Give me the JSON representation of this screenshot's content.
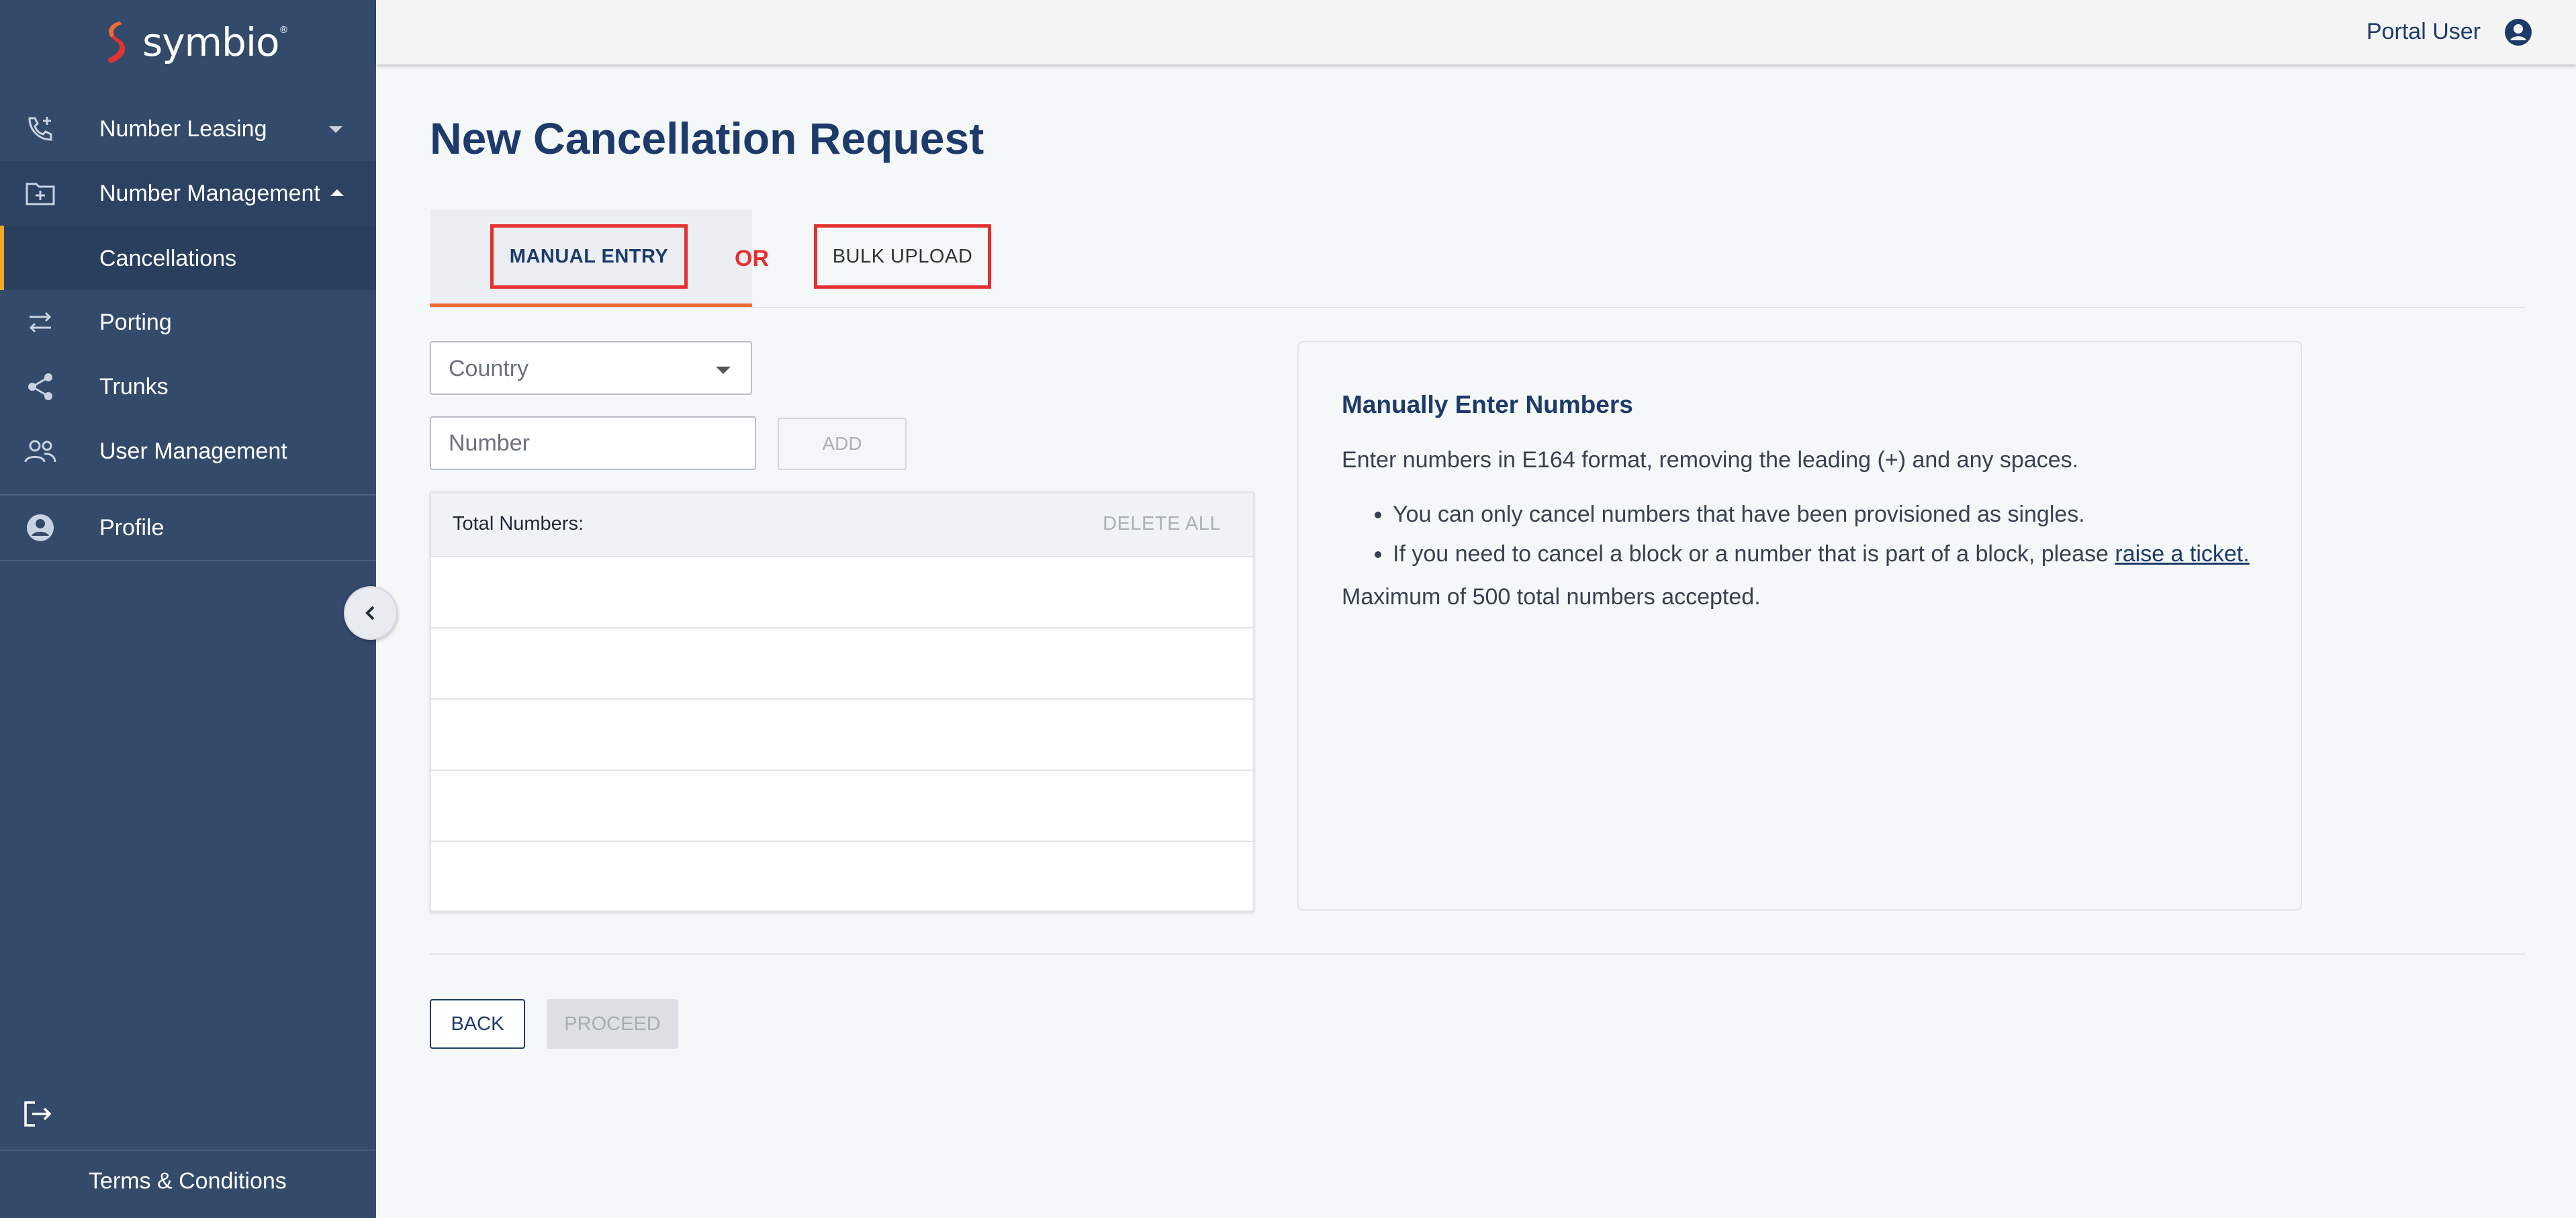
{
  "brand": {
    "name": "symbio",
    "trademark": "®",
    "accent": "#f26b32",
    "mark_color": "#e53030"
  },
  "sidebar": {
    "items": [
      {
        "label": "Number Leasing",
        "icon": "phone-plus-icon",
        "expanded": false
      },
      {
        "label": "Number Management",
        "icon": "folder-plus-icon",
        "expanded": true,
        "children": [
          {
            "label": "Cancellations",
            "active": true
          }
        ]
      },
      {
        "label": "Porting",
        "icon": "swap-arrows-icon"
      },
      {
        "label": "Trunks",
        "icon": "share-nodes-icon"
      },
      {
        "label": "User Management",
        "icon": "users-icon"
      },
      {
        "label": "Profile",
        "icon": "user-circle-icon"
      }
    ],
    "collapse_icon": "chevron-left-icon",
    "logout_icon": "logout-icon",
    "footer_link": "Terms & Conditions"
  },
  "header": {
    "user_name": "Portal User",
    "user_icon": "user-circle-icon"
  },
  "main": {
    "title": "New Cancellation Request",
    "tabs": {
      "manual": "MANUAL ENTRY",
      "separator": "OR",
      "bulk": "BULK UPLOAD",
      "active": "manual"
    },
    "country_select": {
      "placeholder": "Country"
    },
    "number_input": {
      "placeholder": "Number"
    },
    "add_label": "ADD",
    "numbers_table": {
      "header_label": "Total Numbers:",
      "delete_all_label": "DELETE ALL",
      "rows": [
        "",
        "",
        "",
        "",
        ""
      ]
    },
    "info": {
      "title": "Manually Enter Numbers",
      "intro": "Enter numbers in E164 format, removing the leading (+) and any spaces.",
      "bullet_1": "You can only cancel numbers that have been provisioned as singles.",
      "bullet_2_text": "If you need to cancel a block or a number that is part of a block, please ",
      "bullet_2_link": "raise a ticket.",
      "limit": "Maximum of 500 total numbers accepted."
    },
    "back_label": "BACK",
    "proceed_label": "PROCEED"
  }
}
